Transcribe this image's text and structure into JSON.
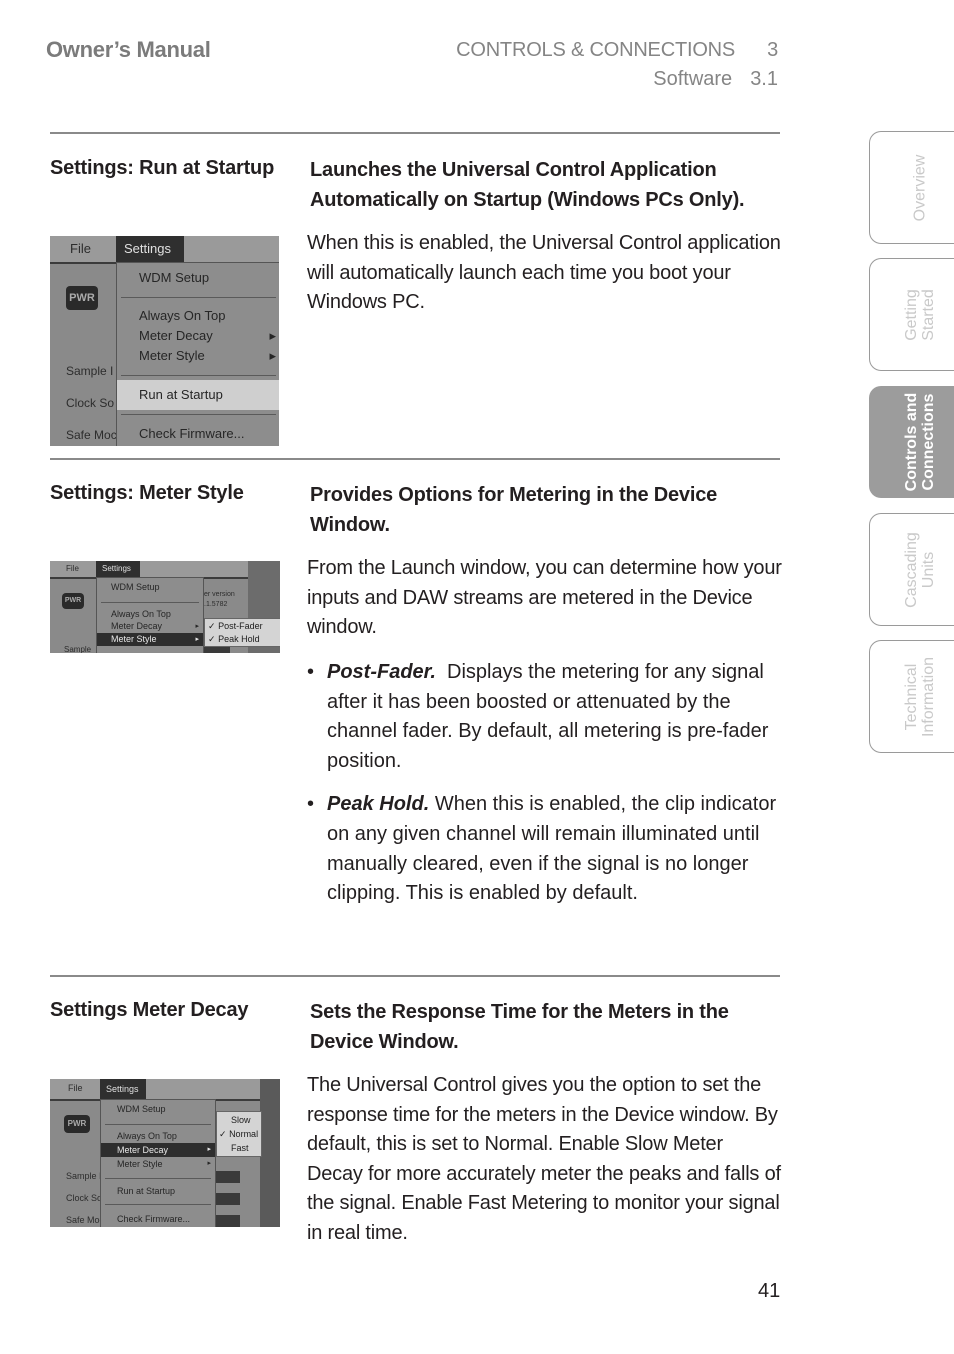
{
  "header": {
    "title": "Owner’s Manual",
    "chapter_label": "CONTROLS & CONNECTIONS",
    "chapter_number": "3",
    "section_label": "Software",
    "section_number": "3.1"
  },
  "sections": [
    {
      "label": "Settings:  Run at Startup",
      "title": "Launches the Universal Control Application Automatically on Startup (Windows PCs Only).",
      "body": "When this is enabled, the Universal Control application will automatically launch each time you boot your Windows PC.",
      "screenshot": {
        "menubar": [
          "File",
          "Settings"
        ],
        "side_labels": [
          "Sample I",
          "Clock So",
          "Safe Moc"
        ],
        "menu_items": [
          "WDM Setup",
          "Always On Top",
          "Meter Decay",
          "Meter Style",
          "Run at Startup",
          "Check Firmware..."
        ],
        "highlighted": "Run at Startup"
      }
    },
    {
      "label": "Settings:  Meter Style",
      "title": "Provides Options for Metering in the Device Window.",
      "body": "From the Launch window, you can determine how your inputs and DAW streams are metered in the Device window.",
      "bullets": [
        {
          "term": "Post-Fader.",
          "text": "  Displays the metering for any signal after it has been boosted or attenuated by the channel fader. By default, all metering is pre-fader position."
        },
        {
          "term": "Peak Hold.",
          "text": " When this is enabled, the clip indicator on any given channel will remain illuminated until manually cleared, even if the signal is no longer clipping. This is enabled by default."
        }
      ],
      "screenshot": {
        "menubar": [
          "File",
          "Settings"
        ],
        "side_labels": [
          "Sample"
        ],
        "version_text": [
          "er version",
          ".1.5782"
        ],
        "menu_items": [
          "WDM Setup",
          "Always On Top",
          "Meter Decay",
          "Meter Style"
        ],
        "highlighted": "Meter Style",
        "submenu": [
          {
            "label": "Post-Fader",
            "checked": true
          },
          {
            "label": "Peak Hold",
            "checked": true
          }
        ]
      }
    },
    {
      "label": "Settings  Meter Decay",
      "title": "Sets the Response Time for the Meters in the Device Window.",
      "body": "The Universal Control gives you the option to set the response time for the meters in the Device window. By default, this is set to Normal. Enable Slow Meter Decay for more accurately meter the peaks and falls of the signal. Enable Fast Metering to monitor your signal in real time.",
      "screenshot": {
        "menubar": [
          "File",
          "Settings"
        ],
        "side_labels": [
          "Sample I",
          "Clock So",
          "Safe Moc"
        ],
        "menu_items": [
          "WDM Setup",
          "Always On Top",
          "Meter Decay",
          "Meter Style",
          "Run at Startup",
          "Check Firmware..."
        ],
        "highlighted": "Meter Decay",
        "submenu": [
          {
            "label": "Slow",
            "checked": false
          },
          {
            "label": "Normal",
            "checked": true
          },
          {
            "label": "Fast",
            "checked": false
          }
        ]
      }
    }
  ],
  "side_tabs": [
    {
      "label": "Overview",
      "active": false
    },
    {
      "label": "Getting Started",
      "line1": "Getting",
      "line2": "Started",
      "active": false
    },
    {
      "label": "Controls and Connections",
      "line1": "Controls and",
      "line2": "Connections",
      "active": true
    },
    {
      "label": "Cascading Units",
      "line1": "Cascading",
      "line2": "Units",
      "active": false
    },
    {
      "label": "Technical Information",
      "line1": "Technical",
      "line2": "Information",
      "active": false
    }
  ],
  "page_number": "41",
  "icons": {
    "submenu_arrow": "▸",
    "checkmark": "✓",
    "bullet": "•",
    "dropdown": "▾"
  }
}
